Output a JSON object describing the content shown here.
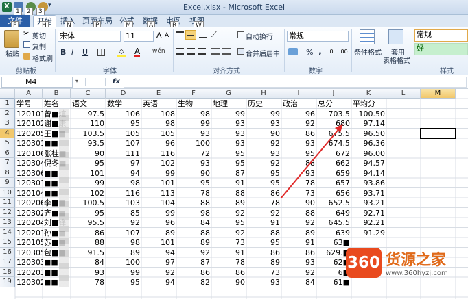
{
  "window": {
    "title": "Excel.xlsx - Microsoft Excel"
  },
  "quick_access": {
    "keys": [
      "1",
      "2",
      "3"
    ]
  },
  "tabs": [
    {
      "label": "文件",
      "key": "F"
    },
    {
      "label": "开始",
      "key": "H"
    },
    {
      "label": "插入",
      "key": "N"
    },
    {
      "label": "页面布局",
      "key": "P"
    },
    {
      "label": "公式",
      "key": "M"
    },
    {
      "label": "数据",
      "key": "A"
    },
    {
      "label": "审阅",
      "key": "R"
    },
    {
      "label": "视图",
      "key": "W"
    }
  ],
  "ribbon": {
    "clipboard": {
      "paste": "粘贴",
      "cut": "剪切",
      "copy": "复制",
      "format_painter": "格式刷",
      "group": "剪贴板"
    },
    "font": {
      "name": "宋体",
      "size": "11",
      "bold": "B",
      "italic": "I",
      "underline": "U",
      "font_color": "A",
      "wen": "wén",
      "group": "字体"
    },
    "alignment": {
      "wrap": "自动换行",
      "merge": "合并后居中",
      "group": "对齐方式"
    },
    "number": {
      "format": "常规",
      "percent": "%",
      "comma": ",",
      "group": "数字"
    },
    "styles": {
      "conditional": "条件格式",
      "table_format_1": "套用",
      "table_format_2": "表格格式",
      "style_normal": "常规",
      "style_good": "好",
      "group": "样式"
    }
  },
  "formula_bar": {
    "name_box": "M4",
    "fx": "fx",
    "content": ""
  },
  "columns": [
    "A",
    "B",
    "C",
    "D",
    "E",
    "F",
    "G",
    "H",
    "I",
    "J",
    "K",
    "L",
    "M"
  ],
  "selected_column": "M",
  "selected_row": "4",
  "row_numbers": [
    "1",
    "2",
    "3",
    "4",
    "5",
    "6",
    "7",
    "8",
    "9",
    "10",
    "11",
    "12",
    "13",
    "14",
    "15",
    "16",
    "17",
    "18",
    "19"
  ],
  "table": {
    "headers": [
      "学号",
      "姓名",
      "语文",
      "数学",
      "英语",
      "生物",
      "地理",
      "历史",
      "政治",
      "总分",
      "平均分"
    ],
    "rows": [
      [
        "120101",
        "曾■煊",
        "97.5",
        "106",
        "108",
        "98",
        "99",
        "99",
        "96",
        "703.5",
        "100.50"
      ],
      [
        "120102",
        "谢■康",
        "110",
        "95",
        "98",
        "99",
        "93",
        "93",
        "92",
        "680",
        "97.14"
      ],
      [
        "120205",
        "王■■",
        "103.5",
        "105",
        "105",
        "93",
        "93",
        "90",
        "86",
        "675.5",
        "96.50"
      ],
      [
        "120301",
        "■■",
        "93.5",
        "107",
        "96",
        "100",
        "93",
        "92",
        "93",
        "674.5",
        "96.36"
      ],
      [
        "120106",
        "张桂■",
        "90",
        "111",
        "116",
        "72",
        "95",
        "93",
        "95",
        "672",
        "96.00"
      ],
      [
        "120304",
        "倪冬■",
        "95",
        "97",
        "102",
        "93",
        "95",
        "92",
        "88",
        "662",
        "94.57"
      ],
      [
        "120306",
        "■■",
        "101",
        "94",
        "99",
        "90",
        "87",
        "95",
        "93",
        "659",
        "94.14"
      ],
      [
        "120301",
        "■■",
        "99",
        "98",
        "101",
        "95",
        "91",
        "95",
        "78",
        "657",
        "93.86"
      ],
      [
        "120104",
        "■■",
        "102",
        "116",
        "113",
        "78",
        "88",
        "86",
        "73",
        "656",
        "93.71"
      ],
      [
        "120206",
        "李■■",
        "100.5",
        "103",
        "104",
        "88",
        "89",
        "78",
        "90",
        "652.5",
        "93.21"
      ],
      [
        "120302",
        "齐■■",
        "95",
        "85",
        "99",
        "98",
        "92",
        "92",
        "88",
        "649",
        "92.71"
      ],
      [
        "120204",
        "刘■锋",
        "95.5",
        "92",
        "96",
        "84",
        "95",
        "91",
        "92",
        "645.5",
        "92.21"
      ],
      [
        "120201",
        "孙■■",
        "86",
        "107",
        "89",
        "88",
        "92",
        "88",
        "89",
        "639",
        "91.29"
      ],
      [
        "120105",
        "苏■■",
        "88",
        "98",
        "101",
        "89",
        "73",
        "95",
        "91",
        "63■",
        ""
      ],
      [
        "120305",
        "包■■",
        "91.5",
        "89",
        "94",
        "92",
        "91",
        "86",
        "86",
        "629.■",
        ""
      ],
      [
        "120303",
        "■■",
        "84",
        "100",
        "97",
        "87",
        "78",
        "89",
        "93",
        "62■",
        ""
      ],
      [
        "120203",
        "■■",
        "93",
        "99",
        "92",
        "86",
        "86",
        "73",
        "92",
        "6■",
        ""
      ],
      [
        "120302",
        "■■",
        "78",
        "95",
        "94",
        "82",
        "90",
        "93",
        "84",
        "61■",
        ""
      ]
    ]
  },
  "watermark": {
    "brand": "360",
    "name": "货源之家",
    "url": "www.360hyzj.com"
  }
}
